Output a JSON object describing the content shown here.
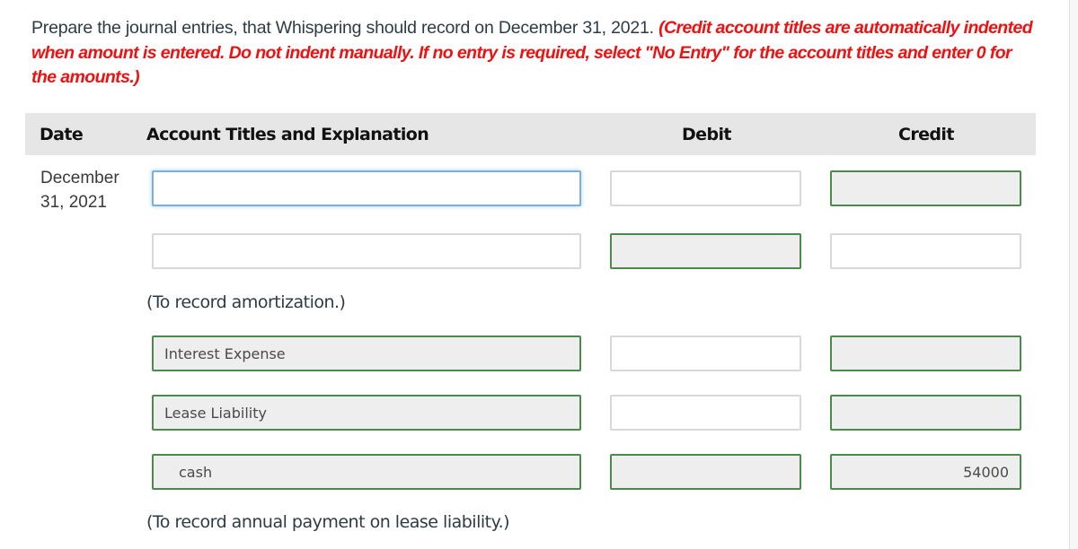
{
  "prompt": {
    "text": "Prepare the journal entries, that Whispering should record on December 31, 2021.",
    "note": "(Credit account titles are automatically indented when amount is entered. Do not indent manually. If no entry is required, select \"No Entry\" for the account titles and enter 0 for the amounts.)"
  },
  "table": {
    "headers": {
      "date": "Date",
      "account": "Account Titles and Explanation",
      "debit": "Debit",
      "credit": "Credit"
    },
    "date_line1": "December",
    "date_line2": "31, 2021",
    "entries": [
      {
        "rows": [
          {
            "account": "",
            "debit": "",
            "credit": ""
          },
          {
            "account": "",
            "debit": "",
            "credit": ""
          }
        ],
        "explanation": "(To record amortization.)"
      },
      {
        "rows": [
          {
            "account": "Interest Expense",
            "debit": "",
            "credit": ""
          },
          {
            "account": "Lease Liability",
            "debit": "",
            "credit": ""
          },
          {
            "account": "cash",
            "debit": "",
            "credit": "54000"
          }
        ],
        "explanation": "(To record annual payment on lease liability.)"
      }
    ]
  }
}
